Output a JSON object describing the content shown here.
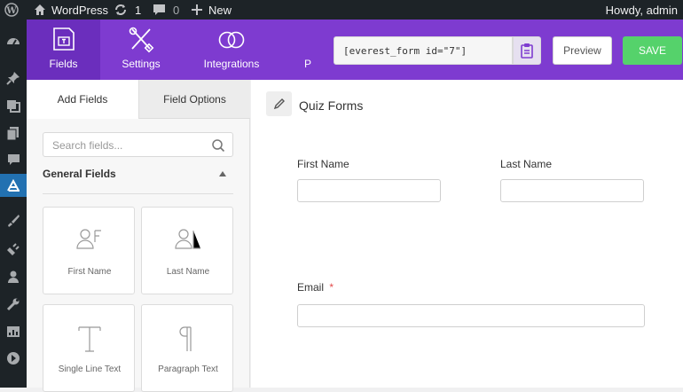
{
  "adminbar": {
    "site_name": "WordPress",
    "updates_count": "1",
    "comments_count": "0",
    "new_label": "New",
    "greeting": "Howdy, admin"
  },
  "builder": {
    "tabs": [
      {
        "label": "Fields",
        "icon": "fields-icon"
      },
      {
        "label": "Settings",
        "icon": "settings-tools-icon"
      },
      {
        "label": "Integrations",
        "icon": "integrations-icon"
      },
      {
        "label": "P",
        "icon": ""
      }
    ],
    "shortcode": "[everest_form id=\"7\"]",
    "preview_label": "Preview",
    "save_label": "SAVE"
  },
  "panel": {
    "tab_add": "Add Fields",
    "tab_options": "Field Options",
    "search_placeholder": "Search fields...",
    "section_title": "General Fields",
    "fields": [
      {
        "label": "First Name",
        "icon": "first-name-icon"
      },
      {
        "label": "Last Name",
        "icon": "last-name-icon"
      },
      {
        "label": "Single Line Text",
        "icon": "single-line-text-icon"
      },
      {
        "label": "Paragraph Text",
        "icon": "paragraph-text-icon"
      }
    ]
  },
  "form": {
    "title": "Quiz Forms",
    "first_name_label": "First Name",
    "last_name_label": "Last Name",
    "email_label": "Email",
    "required_mark": "*"
  },
  "colors": {
    "accent": "#7e3bd0",
    "save": "#55d26b",
    "admin_bar": "#1d2327",
    "active_menu": "#2271b1"
  }
}
